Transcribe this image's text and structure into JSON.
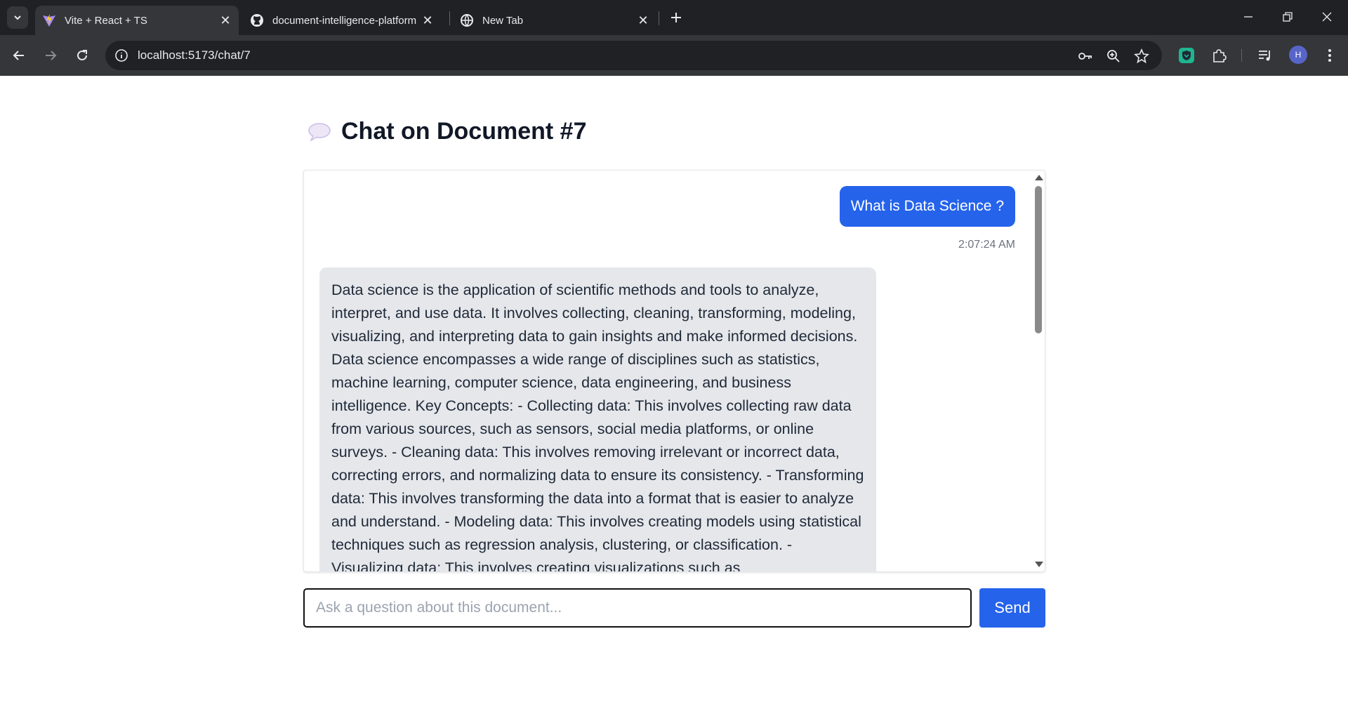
{
  "browser": {
    "tabs": [
      {
        "title": "Vite + React + TS",
        "icon": "vite-icon",
        "active": true
      },
      {
        "title": "document-intelligence-platform",
        "icon": "github-icon",
        "active": false
      },
      {
        "title": "New Tab",
        "icon": "globe-icon",
        "active": false
      }
    ],
    "url": "localhost:5173/chat/7",
    "profile_initial": "H"
  },
  "page": {
    "title": "Chat on Document #7",
    "title_icon": "speech-bubble-icon"
  },
  "chat": {
    "messages": [
      {
        "role": "user",
        "text": "What is Data Science ?",
        "time": "2:07:24 AM"
      },
      {
        "role": "assistant",
        "text": "Data science is the application of scientific methods and tools to analyze, interpret, and use data. It involves collecting, cleaning, transforming, modeling, visualizing, and interpreting data to gain insights and make informed decisions. Data science encompasses a wide range of disciplines such as statistics, machine learning, computer science, data engineering, and business intelligence. Key Concepts: - Collecting data: This involves collecting raw data from various sources, such as sensors, social media platforms, or online surveys. - Cleaning data: This involves removing irrelevant or incorrect data, correcting errors, and normalizing data to ensure its consistency. - Transforming data: This involves transforming the data into a format that is easier to analyze and understand. - Modeling data: This involves creating models using statistical techniques such as regression analysis, clustering, or classification. - Visualizing data: This involves creating visualizations such as"
      }
    ]
  },
  "composer": {
    "placeholder": "Ask a question about this document...",
    "send_label": "Send"
  },
  "colors": {
    "accent": "#2563eb",
    "assistant_bubble": "#e5e7eb",
    "chrome_dark": "#202124"
  }
}
